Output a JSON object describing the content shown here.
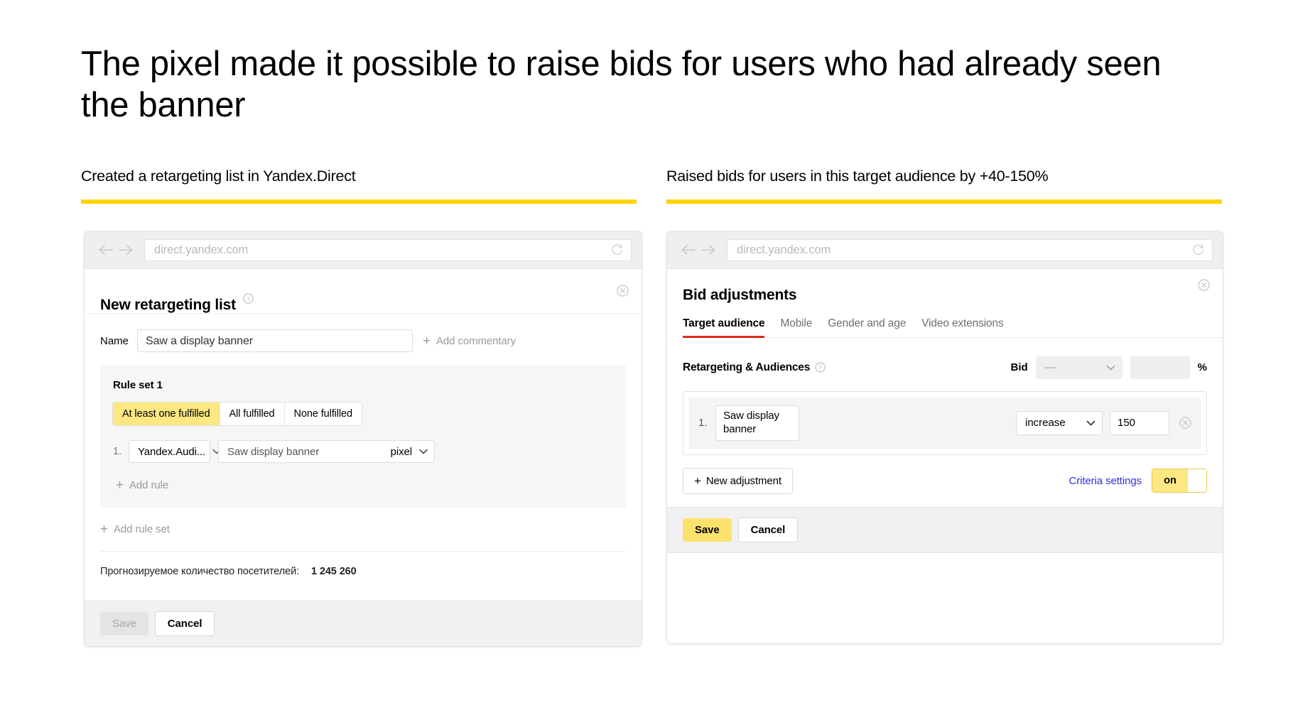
{
  "slide": {
    "title": "The pixel made it possible to raise bids for users who had already seen the banner"
  },
  "columns": {
    "left_caption": "Created a retargeting list in Yandex.Direct",
    "right_caption": "Raised bids for users in this target audience by +40-150%",
    "accent_color": "#FFD400"
  },
  "left_browser": {
    "url": "direct.yandex.com",
    "back_icon": "arrow-left-icon",
    "forward_icon": "arrow-right-icon",
    "reload_icon": "reload-icon",
    "dialog": {
      "title": "New retargeting list",
      "help_icon": "question-mark-icon",
      "close_icon": "close-circle-icon",
      "name_label": "Name",
      "name_value": "Saw a display banner",
      "add_commentary": "Add commentary",
      "rule_set_title": "Rule set  1",
      "segmented": [
        {
          "label": "At least one fulfilled",
          "selected": true
        },
        {
          "label": "All fulfilled",
          "selected": false
        },
        {
          "label": "None fulfilled",
          "selected": false
        }
      ],
      "rule": {
        "index": "1.",
        "source": "Yandex.Audi...",
        "value": "Saw display banner",
        "unit": "pixel"
      },
      "add_rule": "Add rule",
      "add_rule_set": "Add rule set",
      "forecast_label": "Прогнозируемое количество посетителей:",
      "forecast_value": "1 245 260",
      "save_label": "Save",
      "cancel_label": "Cancel"
    }
  },
  "right_browser": {
    "url": "direct.yandex.com",
    "back_icon": "arrow-left-icon",
    "forward_icon": "arrow-right-icon",
    "reload_icon": "reload-icon",
    "dialog": {
      "title": "Bid adjustments",
      "close_icon": "close-circle-icon",
      "tabs": [
        {
          "label": "Target audience",
          "active": true
        },
        {
          "label": "Mobile",
          "active": false
        },
        {
          "label": "Gender and age",
          "active": false
        },
        {
          "label": "Video extensions",
          "active": false
        }
      ],
      "group_label": "Retargeting & Audiences",
      "help_icon": "question-mark-icon",
      "bid_label": "Bid",
      "bid_select_value": "—",
      "bid_input_value": "",
      "percent_symbol": "%",
      "adjustment": {
        "index": "1.",
        "audience": "Saw display banner",
        "operation": "increase",
        "value": "150",
        "remove_icon": "close-circle-icon"
      },
      "new_adjustment_label": "New adjustment",
      "criteria_settings_label": "Criteria settings",
      "toggle_state": "on",
      "save_label": "Save",
      "cancel_label": "Cancel",
      "accent_tab_color": "#e02b20",
      "save_button_color": "#FCE16D"
    }
  }
}
